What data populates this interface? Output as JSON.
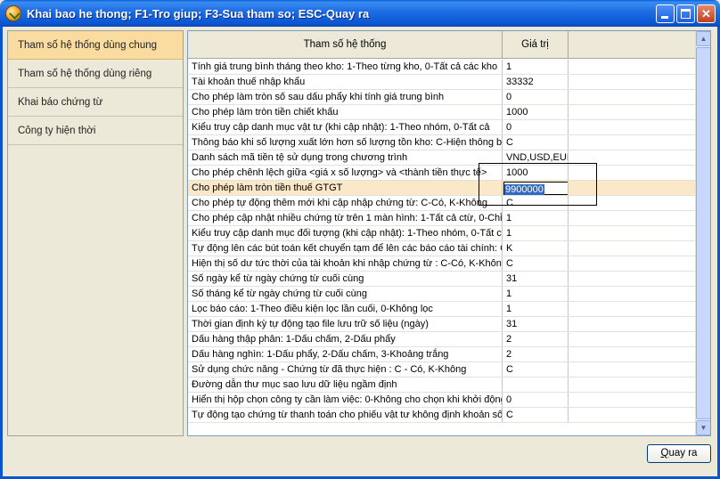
{
  "window": {
    "title": "Khai bao he thong; F1-Tro giup; F3-Sua tham so; ESC-Quay ra"
  },
  "sidebar": {
    "items": [
      {
        "label": "Tham số hệ thống dùng chung",
        "active": true
      },
      {
        "label": "Tham số hệ thống dùng riêng",
        "active": false
      },
      {
        "label": "Khai báo chứng từ",
        "active": false
      },
      {
        "label": "Công ty hiện thời",
        "active": false
      }
    ]
  },
  "grid": {
    "columns": {
      "name": "Tham số hệ thống",
      "value": "Giá trị"
    },
    "rows": [
      {
        "name": "Tính giá trung bình tháng theo kho: 1-Theo từng kho, 0-Tất cả các kho",
        "value": "1"
      },
      {
        "name": "Tài khoản thuế nhập khẩu",
        "value": "33332"
      },
      {
        "name": "Cho phép làm tròn số sau dấu phẩy khi tính giá trung bình",
        "value": "0"
      },
      {
        "name": "Cho phép làm tròn tiền chiết khấu",
        "value": "1000"
      },
      {
        "name": "Kiểu truy cập danh mục vật tư (khi cập nhật): 1-Theo nhóm, 0-Tất cả",
        "value": "0"
      },
      {
        "name": "Thông báo khi số lượng xuất lớn hơn số lượng tồn kho: C-Hiện thông báo",
        "value": "C"
      },
      {
        "name": "Danh sách mã tiền tệ sử dụng trong chương trình",
        "value": "VND,USD,EUR,YE"
      },
      {
        "name": "Cho phép chênh lệch giữa <giá x số lượng> và <thành tiền thực tế>",
        "value": "1000"
      },
      {
        "name": "Cho phép làm tròn tiền thuế GTGT",
        "value": "9900000",
        "selected": true
      },
      {
        "name": "Cho phép tự động thêm mới khi cập nhập chứng từ: C-Có, K-Không",
        "value": "C"
      },
      {
        "name": "Cho phép cập nhật nhiều chứng từ trên 1 màn hình: 1-Tất cả ctừ, 0-Chỉ c",
        "value": "1"
      },
      {
        "name": "Kiểu truy cập danh mục đối tượng (khi cập nhật): 1-Theo nhóm, 0-Tất cả",
        "value": "1"
      },
      {
        "name": "Tự động lên các bút toán kết chuyển tạm để lên các báo cáo tài chính: C",
        "value": "K"
      },
      {
        "name": "Hiện thị số dư tức thời của tài khoản khi  nhập chứng từ : C-Có, K-Không",
        "value": "C"
      },
      {
        "name": "Số ngày kể từ ngày chứng từ cuối cùng",
        "value": "31"
      },
      {
        "name": "Số tháng kể từ ngày chứng từ cuối cùng",
        "value": "1"
      },
      {
        "name": "Lọc báo cáo: 1-Theo điều kiện lọc lần cuối, 0-Không lọc",
        "value": "1"
      },
      {
        "name": "Thời gian định kỳ tự động tạo file lưu trữ số liệu (ngày)",
        "value": "31"
      },
      {
        "name": "Dấu hàng thập phân: 1-Dấu chấm,  2-Dấu phẩy",
        "value": "2"
      },
      {
        "name": "Dấu hàng nghìn: 1-Dấu phẩy,   2-Dấu chấm,   3-Khoảng trắng",
        "value": "2"
      },
      {
        "name": "Sử dụng chức năng - Chứng từ đã thực hiện : C - Có,  K-Không",
        "value": "C"
      },
      {
        "name": "Đường dẫn thư mục sao lưu dữ liệu ngầm định",
        "value": ""
      },
      {
        "name": "Hiển thị hộp chọn công ty cần làm việc: 0-Không cho chọn khi khởi động",
        "value": "0"
      },
      {
        "name": "Tự động tạo chứng từ thanh toán cho phiếu vật tư không định khoản số",
        "value": "C"
      }
    ]
  },
  "buttons": {
    "quit": {
      "label_access": "Q",
      "label_rest": "uay ra"
    }
  },
  "colors": {
    "title_bar": "#0b55d2",
    "sidebar_active": "#fadca0",
    "selected_row": "#fbe8c8",
    "edit_highlight": "#316ac5"
  }
}
